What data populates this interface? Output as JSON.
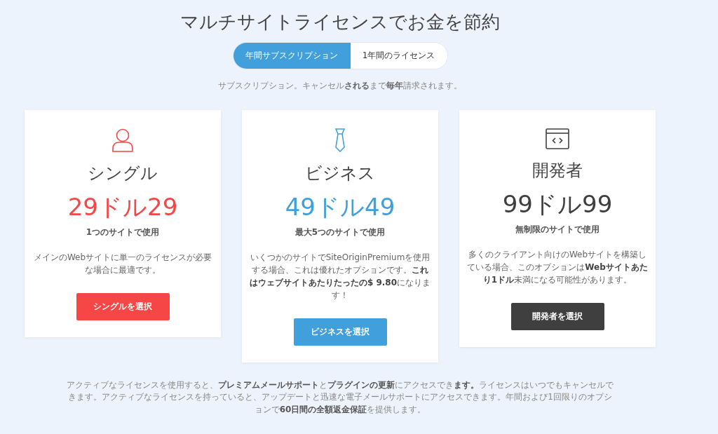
{
  "title": "マルチサイトライセンスでお金を節約",
  "tabs": [
    {
      "label": "年間サブスクリプション",
      "selected": true
    },
    {
      "label": "1年間のライセンス",
      "selected": false
    }
  ],
  "subtitle": "サブスクリプション。キャンセル**される**まで**毎年**請求されます。",
  "plans": [
    {
      "kind": "person",
      "color": "#f64646",
      "name": "シングル",
      "price": "29ドル29",
      "usage": "1つのサイトで使用",
      "description": "メインのWebサイトに単一のライセンスが必要な場合に最適です。",
      "button": "シングルを選択"
    },
    {
      "kind": "tie",
      "color": "#41a0dc",
      "name": "ビジネス",
      "price": "49ドル49",
      "usage": "最大5つのサイトで使用",
      "description": "いくつかのサイトでSiteOriginPremiumを使用する場合、これは優れたオプションです。**これはウェブサイトあたりたったの$ 9.80**になります！",
      "button": "ビジネスを選択"
    },
    {
      "kind": "developer",
      "color": "#3f3f3f",
      "name": "開発者",
      "price": "99ドル99",
      "usage": "無制限のサイトで使用",
      "description": "多くのクライアント向けのWebサイトを構築している場合、このオプションは**Webサイトあたり1ドル**未満になる可能性があります。",
      "button": "開発者を選択"
    }
  ],
  "footer": "アクティブなライセンスを使用すると、**プレミアムメールサポート**と**プラグインの更新**にアクセスでき**ます。**ライセンスはいつでもキャンセルできます。アクティブなライセンスを持っていると、アップデートと迅速な電子メールサポートにアクセスできます。年間および1回限りのオプションで**60日間の全額返金保証**を提供します。"
}
